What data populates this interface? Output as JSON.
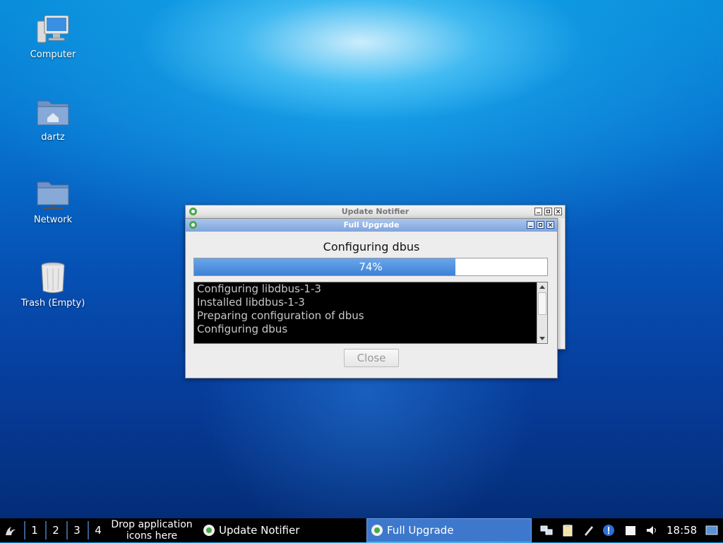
{
  "desktop": {
    "icons": [
      {
        "label": "Computer",
        "icon": "computer-icon"
      },
      {
        "label": "dartz",
        "icon": "home-folder-icon"
      },
      {
        "label": "Network",
        "icon": "network-folder-icon"
      },
      {
        "label": "Trash (Empty)",
        "icon": "trash-icon"
      }
    ]
  },
  "notifier_window": {
    "title": "Update Notifier"
  },
  "upgrade_window": {
    "title": "Full Upgrade",
    "status": "Configuring dbus",
    "progress": 0.74,
    "progress_label": "74%",
    "log_lines": [
      "Configuring libdbus-1-3",
      "Installed libdbus-1-3",
      "Preparing configuration of dbus",
      "Configuring dbus"
    ],
    "close_label": "Close"
  },
  "taskbar": {
    "desktops": [
      "1",
      "2",
      "3",
      "4"
    ],
    "drop_line1": "Drop application",
    "drop_line2": "icons here",
    "tasks": [
      {
        "label": "Update Notifier",
        "active": false
      },
      {
        "label": "Full Upgrade",
        "active": true
      }
    ],
    "clock": "18:58",
    "tray_icons": [
      "network-icon",
      "clipboard-icon",
      "pen-icon",
      "info-icon",
      "notes-icon",
      "volume-icon",
      "screen-icon"
    ]
  },
  "colors": {
    "accent": "#3d78cc",
    "progress": "#4a8fe0",
    "titlebar_active": "#8fb2e4"
  }
}
